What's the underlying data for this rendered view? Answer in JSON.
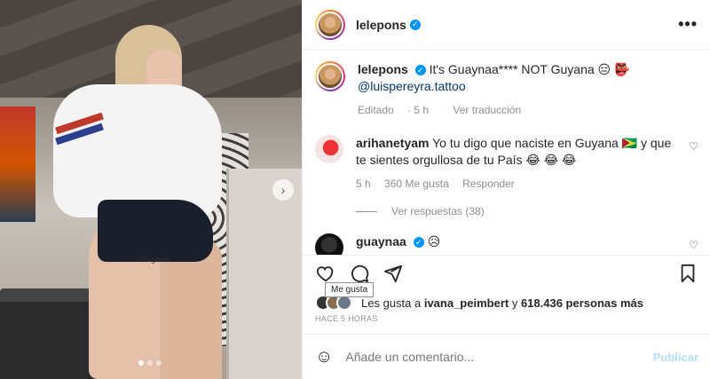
{
  "post": {
    "author": "lelepons",
    "media_pagination": {
      "count": 3,
      "active_index": 0
    }
  },
  "caption": {
    "username": "lelepons",
    "text": "It's Guaynaa**** NOT Guyana 😑 👺",
    "mention": "@luispereyra.tattoo",
    "edited": "Editado",
    "time": "5 h",
    "see_translation": "Ver traducción"
  },
  "comments": [
    {
      "username": "arihanetyam",
      "text": "Yo tu digo que naciste en Guyana 🇬🇾 y que te sientes orgullosa de tu País 😂 😂 😂",
      "time": "5 h",
      "likes": "360 Me gusta",
      "reply": "Responder",
      "view_replies": "Ver respuestas (38)"
    },
    {
      "username": "guaynaa",
      "text": "😥"
    }
  ],
  "tattoo_text": "Guaynaa",
  "tooltip": "Me gusta",
  "likes": {
    "prefix": "Les gusta a ",
    "user": "ivana_peimbert",
    "middle": " y ",
    "count": "618.436 personas más"
  },
  "timestamp": "HACE 5 HORAS",
  "add_comment": {
    "placeholder": "Añade un comentario...",
    "post_label": "Publicar"
  },
  "colors": {
    "verified": "#0095f6",
    "link": "#00376b",
    "muted": "#8e8e8e",
    "publish_disabled": "#b2dffc"
  }
}
